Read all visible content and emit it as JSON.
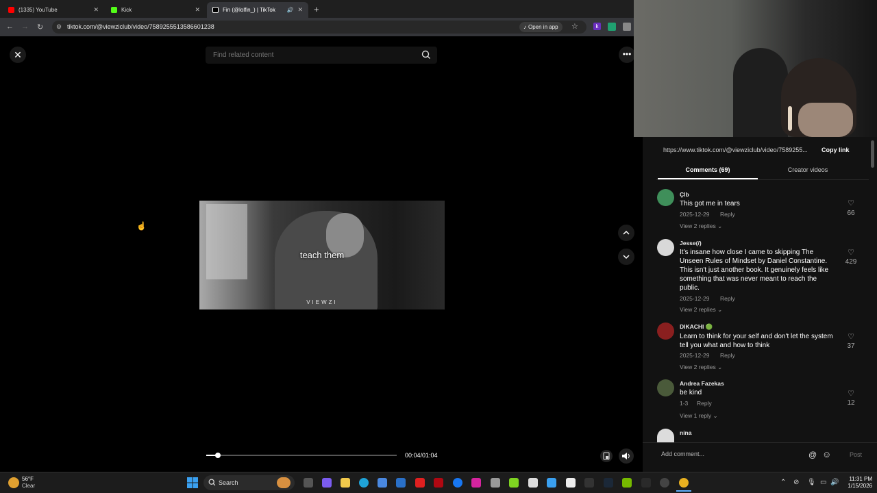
{
  "browser": {
    "tabs": [
      {
        "title": "(1335) YouTube",
        "color": "#ff0000"
      },
      {
        "title": "Kick",
        "color": "#53fc18"
      },
      {
        "title": "Fin (@lolfin_) | TikTok",
        "color": "#ffffff"
      }
    ],
    "url": "tiktok.com/@viewziclub/video/7589255513586601238",
    "open_in_app": "Open in app"
  },
  "player": {
    "search_placeholder": "Find related content",
    "caption": "teach them",
    "watermark": "VIEWZI",
    "time": "00:04/01:04",
    "progress": 0.0625
  },
  "panel": {
    "link": "https://www.tiktok.com/@viewziclub/video/7589255...",
    "copy_link": "Copy link",
    "tabs": {
      "comments": "Comments (69)",
      "creator": "Creator videos"
    },
    "reply_label": "Reply",
    "comments": [
      {
        "name": "Çlb",
        "text": "This got me in tears",
        "date": "2025-12-29",
        "view": "View 2 replies",
        "likes": "66",
        "avatar_color": "#3f8f5a"
      },
      {
        "name": "Jesse(/)",
        "text": "It's insane how close I came to skipping The Unseen Rules of Mindset by Daniel Constantine. This isn't just another book. It genuinely feels like something that was never meant to reach the public.",
        "date": "2025-12-29",
        "view": "View 2 replies",
        "likes": "429",
        "avatar_color": "#d8d8d8"
      },
      {
        "name": "DIKACHI 🟢",
        "text": "Learn to think for your self and don't let the system tell you what and how to think",
        "date": "2025-12-29",
        "view": "View 2 replies",
        "likes": "37",
        "avatar_color": "#8a1f1f"
      },
      {
        "name": "Andrea Fazekas",
        "text": "be kind",
        "date": "1-3",
        "view": "View 1 reply",
        "likes": "12",
        "avatar_color": "#4a5a3a"
      },
      {
        "name": "nina",
        "text": "",
        "date": "",
        "view": "",
        "likes": "",
        "avatar_color": "#dcdcdc"
      }
    ],
    "add_comment": "Add comment...",
    "post": "Post"
  },
  "taskbar": {
    "weather_temp": "56°F",
    "weather_desc": "Clear",
    "search": "Search",
    "time": "11:31 PM",
    "date": "1/15/2026"
  }
}
